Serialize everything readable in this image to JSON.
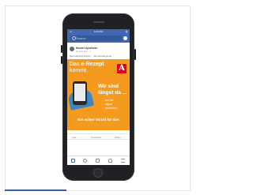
{
  "status_bar": {
    "carrier": "•••",
    "time": "9:23 PM",
    "battery": "▮"
  },
  "search": {
    "placeholder": "Search"
  },
  "post": {
    "author": "Muster Apotheke",
    "meta": "Gesponsert · ⚬",
    "text": "Das e-Rezept kommt … Wir sind längst da …"
  },
  "ad": {
    "title_prefix": "Das ",
    "title_bold": "e-Rezept",
    "title_line2": "kommt.",
    "logo_letter": "A",
    "headline_1": "Wir sind",
    "headline_2": "längst da ...",
    "sub_lines": [
      "... vor Ort.",
      "... digital.",
      "... persönlich."
    ],
    "footer": "Ein echter Vorteil für Sie!",
    "brand_color": "#e2001a",
    "background_color": "#f39a1f"
  },
  "actions": {
    "like": "Like",
    "comment": "Comment",
    "share": "Share"
  },
  "tabbar": {
    "icons": [
      "news-feed-icon",
      "groups-icon",
      "marketplace-icon",
      "notifications-icon",
      "menu-icon"
    ]
  }
}
